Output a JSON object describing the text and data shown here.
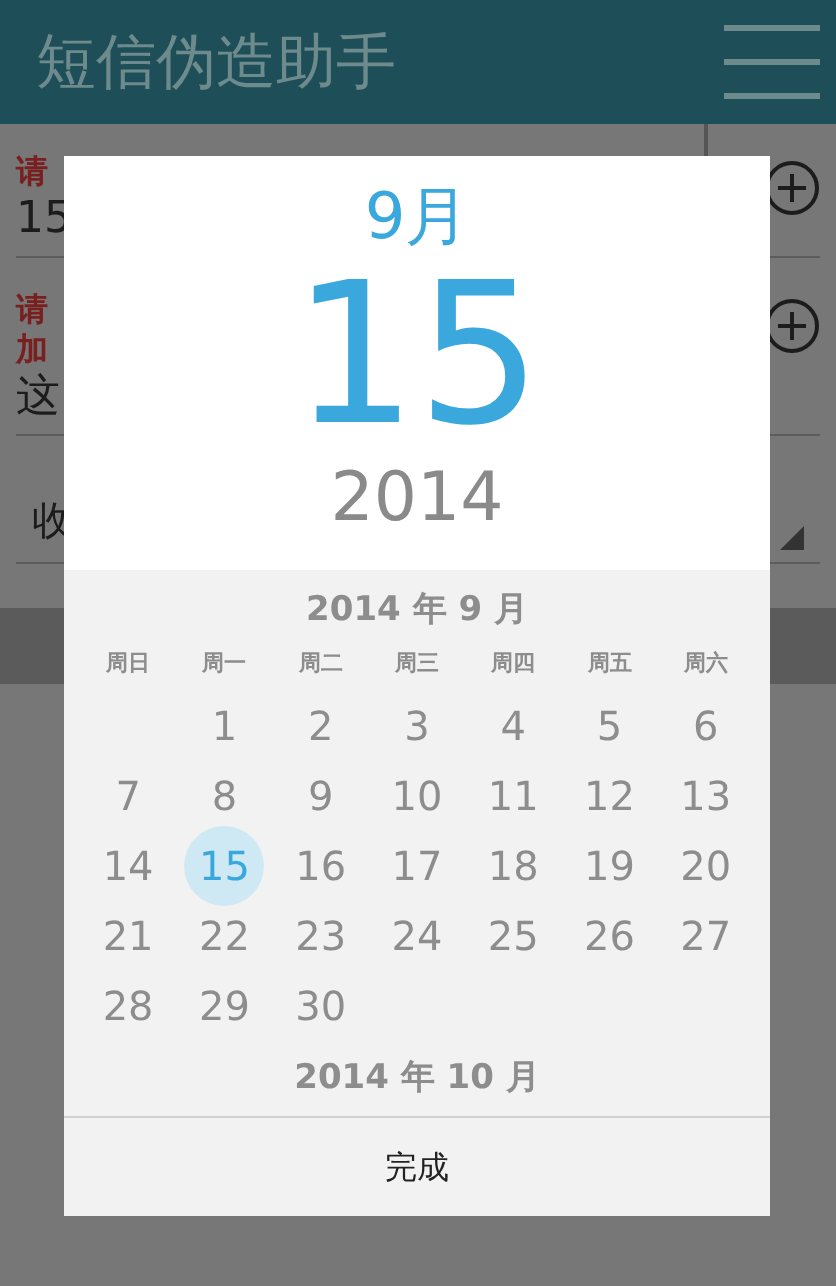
{
  "app_bar": {
    "title": "短信伪造助手"
  },
  "form": {
    "fields": [
      {
        "label_lines": [
          "请"
        ],
        "value": "15"
      },
      {
        "label_lines": [
          "请",
          "加"
        ],
        "value": "这"
      }
    ],
    "dropdown": {
      "value": "收"
    }
  },
  "date_dialog": {
    "month_header": "9月",
    "day_header": "15",
    "year_header": "2014",
    "month_title": "2014 年 9 月",
    "weekdays": [
      "周日",
      "周一",
      "周二",
      "周三",
      "周四",
      "周五",
      "周六"
    ],
    "weeks": [
      {
        "kind": "first",
        "days": [
          {
            "day": "1",
            "selected": false
          },
          {
            "day": "2",
            "selected": false
          },
          {
            "day": "3",
            "selected": false
          },
          {
            "day": "4",
            "selected": false
          },
          {
            "day": "5",
            "selected": false
          },
          {
            "day": "6",
            "selected": false
          }
        ]
      },
      {
        "kind": "regular",
        "days": [
          {
            "day": "7",
            "selected": false
          },
          {
            "day": "8",
            "selected": false
          },
          {
            "day": "9",
            "selected": false
          },
          {
            "day": "10",
            "selected": false
          },
          {
            "day": "11",
            "selected": false
          },
          {
            "day": "12",
            "selected": false
          },
          {
            "day": "13",
            "selected": false
          }
        ]
      },
      {
        "kind": "regular",
        "days": [
          {
            "day": "14",
            "selected": false
          },
          {
            "day": "15",
            "selected": true
          },
          {
            "day": "16",
            "selected": false
          },
          {
            "day": "17",
            "selected": false
          },
          {
            "day": "18",
            "selected": false
          },
          {
            "day": "19",
            "selected": false
          },
          {
            "day": "20",
            "selected": false
          }
        ]
      },
      {
        "kind": "regular",
        "days": [
          {
            "day": "21",
            "selected": false
          },
          {
            "day": "22",
            "selected": false
          },
          {
            "day": "23",
            "selected": false
          },
          {
            "day": "24",
            "selected": false
          },
          {
            "day": "25",
            "selected": false
          },
          {
            "day": "26",
            "selected": false
          },
          {
            "day": "27",
            "selected": false
          }
        ]
      },
      {
        "kind": "regular",
        "days": [
          {
            "day": "28",
            "selected": false
          },
          {
            "day": "29",
            "selected": false
          },
          {
            "day": "30",
            "selected": false
          }
        ]
      }
    ],
    "next_month_title": "2014 年 10 月",
    "done_button": "完成"
  }
}
